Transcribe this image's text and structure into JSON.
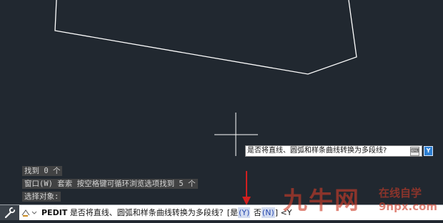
{
  "drawing": {
    "line_color": "#ffffff",
    "background": "#212830"
  },
  "history": {
    "lines": [
      "找到 0 个",
      "窗口(W) 套索  按空格键可循环浏览选项找到 5 个",
      "选择对象:"
    ]
  },
  "tooltip": {
    "text": "是否将直线、圆弧和样条曲线转换为多段线?",
    "icon": "keyboard-icon",
    "dynamic_input_label": "Y"
  },
  "command_line": {
    "command": "PEDIT",
    "question": "是否将直线、圆弧和样条曲线转换为多段线？[",
    "option_yes_label": "是",
    "option_yes_key": "(Y)",
    "option_no_label": "否",
    "option_no_key": "(N)",
    "tail": "] <Y",
    "wrench_icon": "wrench-icon",
    "prompt_icon": "command-prompt-icon"
  },
  "annotation": {
    "arrow_color": "#d21f1f"
  },
  "watermark": {
    "logo": "九牛网",
    "tagline": "在线自学",
    "url": "9npx.com"
  }
}
